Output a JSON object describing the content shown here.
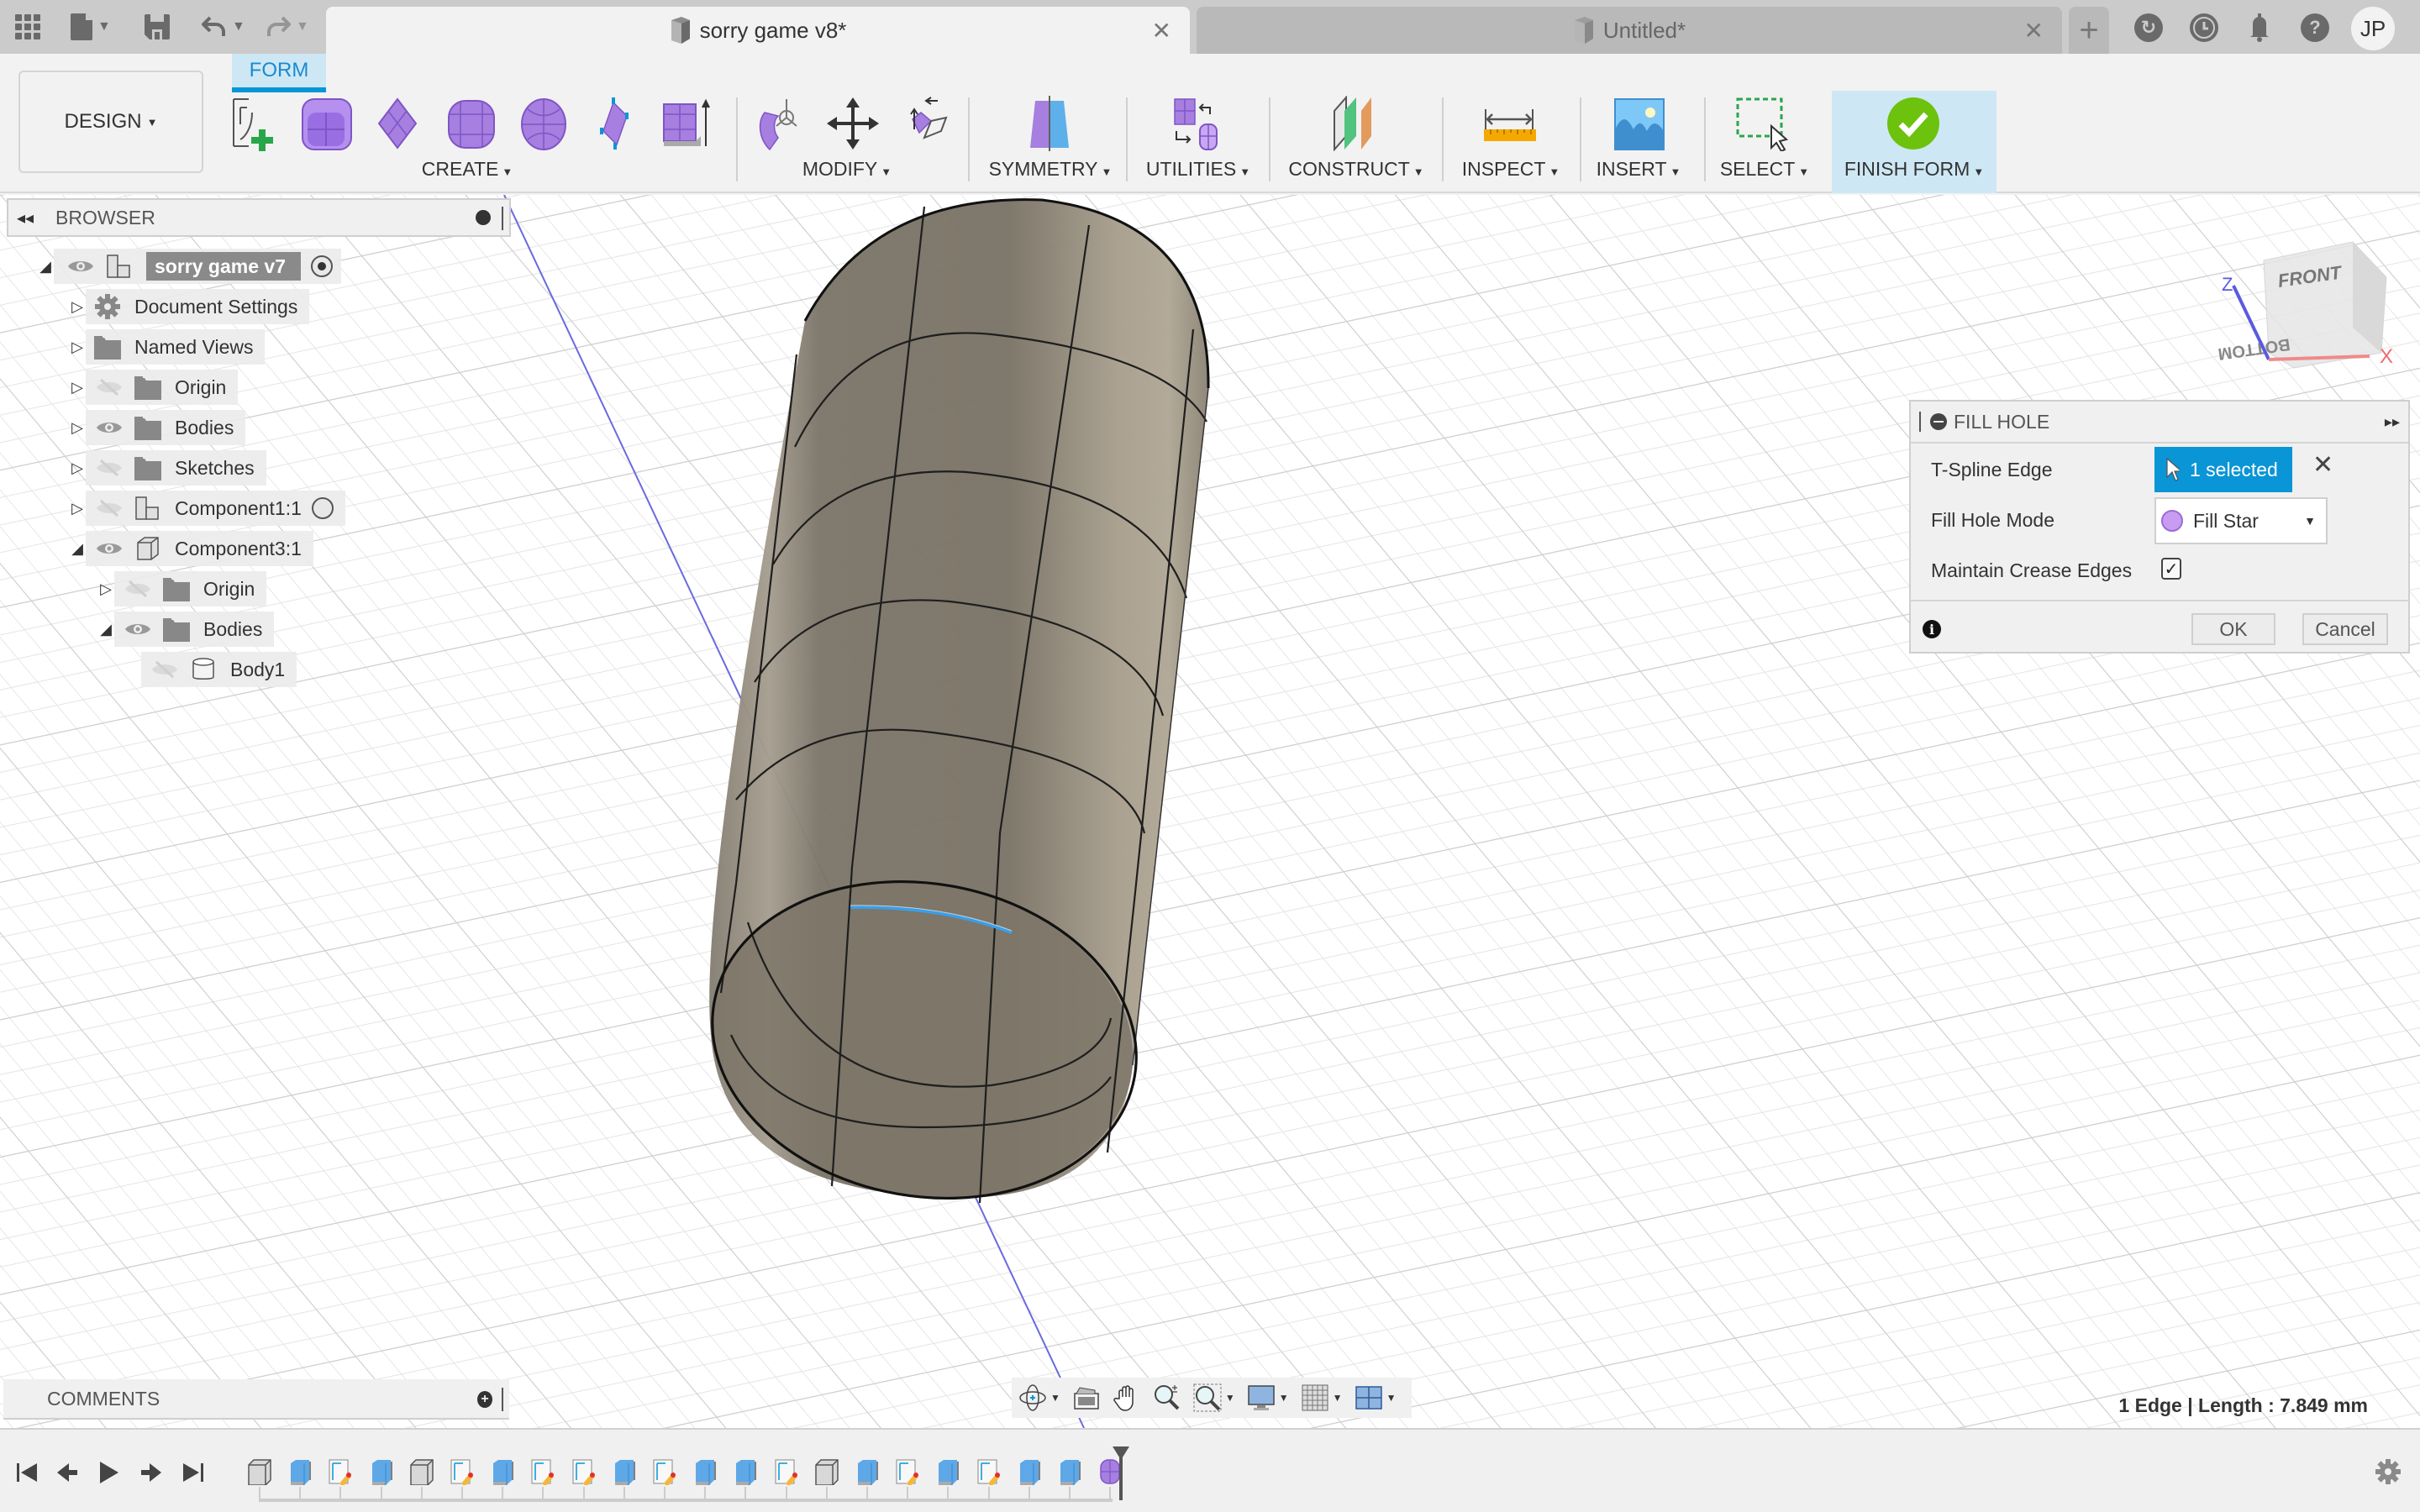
{
  "app": {
    "toolbar_left": {
      "apps_icon": "grid-icon",
      "file_icon": "file-icon",
      "save_icon": "save-icon",
      "undo_icon": "undo-icon",
      "redo_icon": "redo-icon"
    },
    "tabs": [
      {
        "label": "sorry game v8*",
        "active": true
      },
      {
        "label": "Untitled*",
        "active": false
      }
    ],
    "right_icons": [
      "extensions-icon",
      "job-status-icon",
      "notifications-icon",
      "help-icon"
    ],
    "user_initials": "JP"
  },
  "ribbon": {
    "workspace": "DESIGN",
    "active_tab": "FORM",
    "groups": [
      {
        "label": "CREATE",
        "tools": [
          "create-form-sketch",
          "box",
          "plane",
          "cylinder",
          "sphere",
          "face",
          "extrude"
        ]
      },
      {
        "label": "MODIFY",
        "tools": [
          "edit-form",
          "move",
          "insert-edge"
        ]
      },
      {
        "label": "SYMMETRY",
        "tools": [
          "mirror-internal"
        ]
      },
      {
        "label": "UTILITIES",
        "tools": [
          "convert"
        ]
      },
      {
        "label": "CONSTRUCT",
        "tools": [
          "offset-plane"
        ]
      },
      {
        "label": "INSPECT",
        "tools": [
          "measure"
        ]
      },
      {
        "label": "INSERT",
        "tools": [
          "insert-canvas"
        ]
      },
      {
        "label": "SELECT",
        "tools": [
          "window-select"
        ]
      },
      {
        "label": "FINISH FORM",
        "tools": [
          "finish-form"
        ]
      }
    ]
  },
  "browser": {
    "title": "BROWSER",
    "tree": [
      {
        "label": "sorry game v7",
        "level": 0,
        "expanded": true,
        "visible": true,
        "icon": "component",
        "root": true,
        "active_radio": true
      },
      {
        "label": "Document Settings",
        "level": 1,
        "expanded": false,
        "icon": "gear"
      },
      {
        "label": "Named Views",
        "level": 1,
        "expanded": false,
        "icon": "folder"
      },
      {
        "label": "Origin",
        "level": 1,
        "expanded": false,
        "visible": false,
        "icon": "folder"
      },
      {
        "label": "Bodies",
        "level": 1,
        "expanded": false,
        "visible": true,
        "icon": "folder"
      },
      {
        "label": "Sketches",
        "level": 1,
        "expanded": false,
        "visible": false,
        "icon": "folder"
      },
      {
        "label": "Component1:1",
        "level": 1,
        "expanded": false,
        "visible": false,
        "icon": "component",
        "radio": true
      },
      {
        "label": "Component3:1",
        "level": 1,
        "expanded": true,
        "visible": true,
        "icon": "box"
      },
      {
        "label": "Origin",
        "level": 2,
        "expanded": false,
        "visible": false,
        "icon": "folder"
      },
      {
        "label": "Bodies",
        "level": 2,
        "expanded": true,
        "visible": true,
        "icon": "folder"
      },
      {
        "label": "Body1",
        "level": 3,
        "visible": false,
        "icon": "body"
      }
    ]
  },
  "viewcube": {
    "top_face": "FRONT",
    "bottom_face": "BOTTOM",
    "axes": [
      "Z",
      "X"
    ]
  },
  "dialog": {
    "title": "FILL HOLE",
    "fields": {
      "tspline_edge_label": "T-Spline Edge",
      "tspline_edge_value": "1 selected",
      "fill_mode_label": "Fill Hole Mode",
      "fill_mode_value": "Fill Star",
      "crease_label": "Maintain Crease Edges",
      "crease_checked": true
    },
    "ok_label": "OK",
    "cancel_label": "Cancel",
    "accent": "#0a95d6"
  },
  "comments": {
    "title": "COMMENTS"
  },
  "navbar": [
    "orbit-icon",
    "look-at-icon",
    "pan-icon",
    "zoom-icon",
    "fit-icon",
    "display-settings-icon",
    "grid-icon",
    "viewports-icon"
  ],
  "status": {
    "selection_info": "1 Edge | Length : 7.849 mm"
  },
  "timeline": {
    "controls": [
      "first",
      "previous",
      "play",
      "next",
      "last"
    ],
    "items": [
      "body",
      "extrude",
      "sketch",
      "extrude",
      "body",
      "sketch",
      "extrude",
      "sketch",
      "sketch",
      "extrude",
      "sketch",
      "extrude",
      "extrude",
      "sketch",
      "body",
      "extrude",
      "sketch",
      "extrude",
      "sketch",
      "extrude",
      "extrude",
      "form"
    ]
  },
  "colors": {
    "accent_blue": "#0696d7",
    "form_purple": "#a67fe0",
    "finish_green": "#6cc20d",
    "body_color": "#8f8779"
  }
}
